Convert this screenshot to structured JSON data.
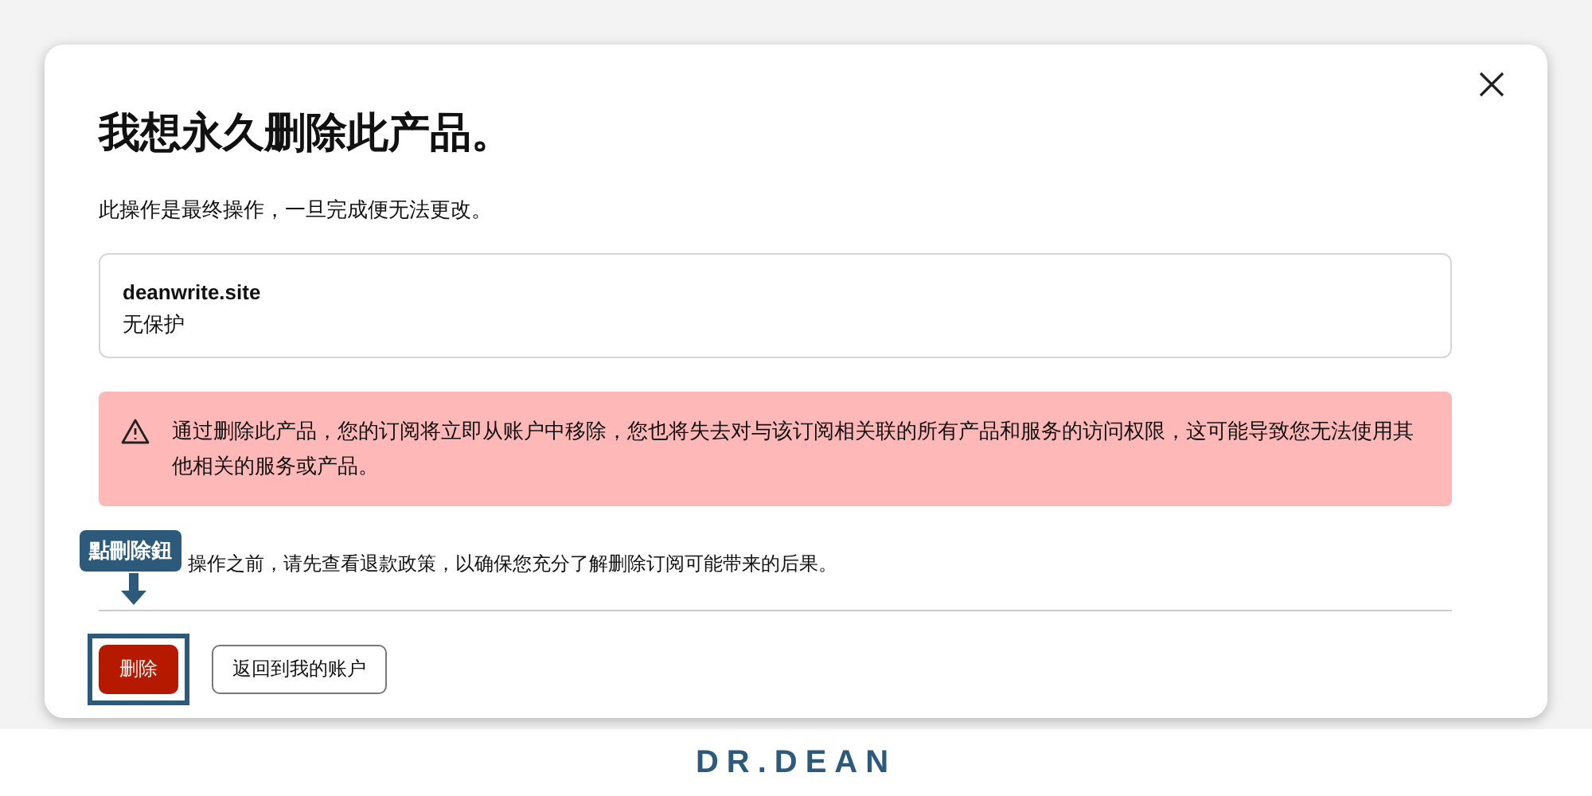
{
  "dialog": {
    "title": "我想永久删除此产品。",
    "subtitle": "此操作是最终操作，一旦完成便无法更改。",
    "product": {
      "domain": "deanwrite.site",
      "status": "无保护"
    },
    "alert": {
      "text": "通过删除此产品，您的订阅将立即从账户中移除，您也将失去对与该订阅相关联的所有产品和服务的访问权限，这可能导致您无法使用其他相关的服务或产品。"
    },
    "note": "操作之前，请先查看退款政策，以确保您充分了解删除订阅可能带来的后果。",
    "buttons": [
      {
        "label": "删除",
        "kind": "danger"
      },
      {
        "label": "返回到我的账户",
        "kind": "outline"
      }
    ]
  },
  "annotation": {
    "label": "點刪除鈕"
  },
  "footer": {
    "logo": "DR.DEAN"
  }
}
